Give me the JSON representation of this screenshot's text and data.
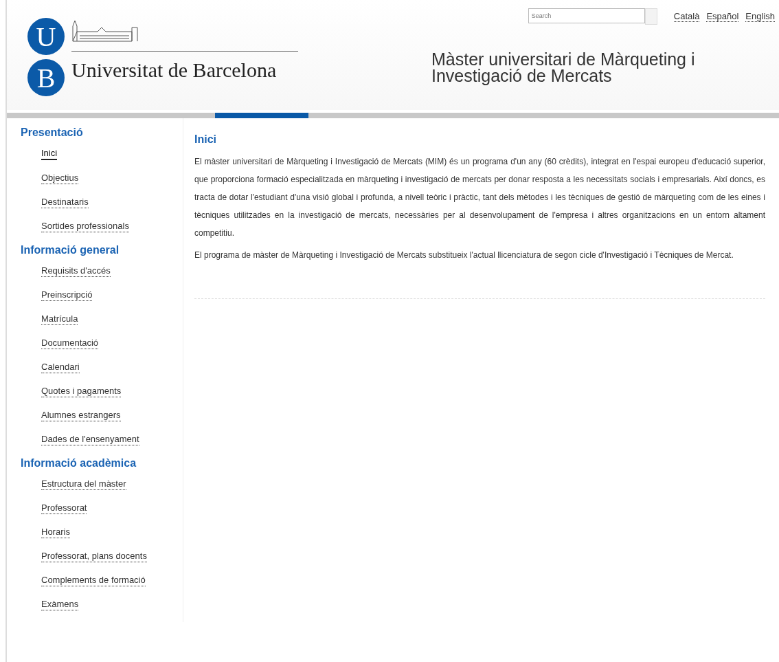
{
  "logo": {
    "letters": [
      "U",
      "B"
    ],
    "name": "Universitat de Barcelona"
  },
  "search": {
    "placeholder": "Search"
  },
  "languages": [
    "Català",
    "Español",
    "English"
  ],
  "site_title": "Màster universitari de Màrqueting i Investigació de Mercats",
  "sidebar": [
    {
      "heading": "Presentació",
      "items": [
        {
          "label": "Inici",
          "selected": true
        },
        {
          "label": "Objectius",
          "selected": false
        },
        {
          "label": "Destinataris",
          "selected": false
        },
        {
          "label": "Sortides professionals",
          "selected": false
        }
      ]
    },
    {
      "heading": "Informació general",
      "items": [
        {
          "label": "Requisits d'accés",
          "selected": false
        },
        {
          "label": "Preinscripció",
          "selected": false
        },
        {
          "label": "Matrícula",
          "selected": false
        },
        {
          "label": "Documentació",
          "selected": false
        },
        {
          "label": "Calendari",
          "selected": false
        },
        {
          "label": "Quotes i pagaments",
          "selected": false
        },
        {
          "label": "Alumnes estrangers",
          "selected": false
        },
        {
          "label": "Dades de l'ensenyament",
          "selected": false
        }
      ]
    },
    {
      "heading": "Informació acadèmica",
      "items": [
        {
          "label": "Estructura del màster",
          "selected": false
        },
        {
          "label": "Professorat",
          "selected": false
        },
        {
          "label": "Horaris",
          "selected": false
        },
        {
          "label": "Professorat, plans docents",
          "selected": false
        },
        {
          "label": "Complements de formació",
          "selected": false
        },
        {
          "label": "Exàmens",
          "selected": false
        }
      ]
    }
  ],
  "content": {
    "title": "Inici",
    "paragraphs": [
      "El màster universitari de Màrqueting i Investigació de Mercats (MIM) és un programa d'un any (60 crèdits), integrat en l'espai europeu d'educació superior, que proporciona formació especialitzada en màrqueting i investigació de mercats per donar resposta a les necessitats socials i empresarials. Així doncs, es tracta de dotar l'estudiant d'una visió global i profunda, a nivell teòric i pràctic, tant dels mètodes i les tècniques de gestió de màrqueting com de les eines i tècniques utilitzades en la investigació de mercats, necessàries per al desenvolupament de l'empresa i altres organitzacions en un entorn altament competitiu.",
      "El programa de màster de Màrqueting i Investigació de Mercats substitueix l'actual llicenciatura de segon cicle d'Investigació i Tècniques de Mercat."
    ]
  }
}
